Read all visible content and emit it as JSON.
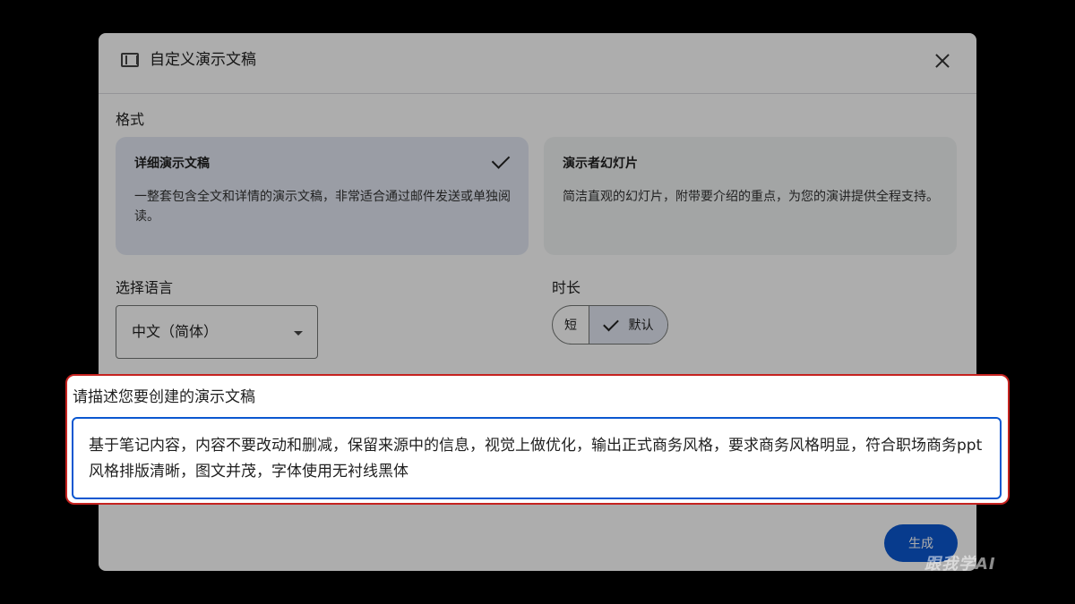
{
  "dialog": {
    "title": "自定义演示文稿",
    "title_icon": "slides-icon",
    "close_icon": "close-icon"
  },
  "format": {
    "label": "格式",
    "options": [
      {
        "title": "详细演示文稿",
        "description": "一整套包含全文和详情的演示文稿，非常适合通过邮件发送或单独阅读。",
        "selected": true
      },
      {
        "title": "演示者幻灯片",
        "description": "简洁直观的幻灯片，附带要介绍的重点，为您的演讲提供全程支持。",
        "selected": false
      }
    ]
  },
  "language": {
    "label": "选择语言",
    "selected": "中文（简体）"
  },
  "duration": {
    "label": "时长",
    "options": [
      "短",
      "默认"
    ],
    "selected": "默认"
  },
  "prompt": {
    "label": "请描述您要创建的演示文稿",
    "value": "基于笔记内容，内容不要改动和删减，保留来源中的信息，视觉上做优化，输出正式商务风格，要求商务风格明显，符合职场商务ppt风格排版清晰，图文并茂，字体使用无衬线黑体"
  },
  "actions": {
    "generate_label": "生成"
  },
  "colors": {
    "accent": "#0b57d0",
    "highlight_border": "#c5221f",
    "selected_card": "#e3e8f3"
  },
  "watermark": "跟我学AI"
}
